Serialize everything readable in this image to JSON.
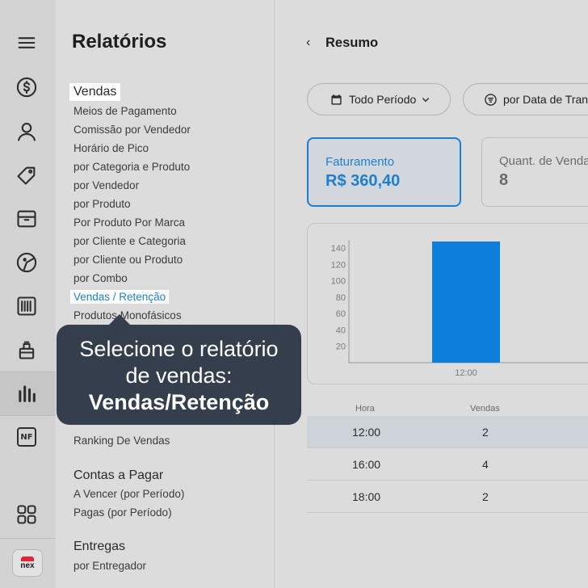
{
  "rail": {
    "icons": [
      "menu-icon",
      "dollar-icon",
      "user-icon",
      "tag-icon",
      "box-icon",
      "pizza-icon",
      "barcode-icon",
      "kitchen-icon",
      "bar-chart-icon",
      "nf-icon",
      "apps-grid-icon"
    ],
    "nf_label": "NF",
    "logo_text": "nex"
  },
  "panel": {
    "title": "Relatórios",
    "groups": {
      "vendas": {
        "label": "Vendas",
        "items": [
          "Meios de Pagamento",
          "Comissão por Vendedor",
          "Horário de Pico",
          "por Categoria e Produto",
          "por Vendedor",
          "por Produto",
          "Por Produto Por Marca",
          "por Cliente e Categoria",
          "por Cliente ou Produto",
          "por Combo",
          "Vendas / Retenção",
          "Produtos Monofásicos",
          "Ranking De Vendas"
        ]
      },
      "contas": {
        "label": "Contas a Pagar",
        "items": [
          "A Vencer (por Período)",
          "Pagas (por Período)"
        ]
      },
      "entregas": {
        "label": "Entregas",
        "items": [
          "por Entregador"
        ]
      }
    }
  },
  "tooltip": {
    "line1": "Selecione o relatório",
    "line2": "de vendas:",
    "line3": "Vendas/Retenção"
  },
  "main": {
    "back_glyph": "‹",
    "title": "Resumo",
    "filters": [
      "Todo Período",
      "por Data de Transação"
    ],
    "cards": [
      {
        "label": "Faturamento",
        "value": "R$ 360,40"
      },
      {
        "label": "Quant. de Vendas",
        "value": "8"
      }
    ],
    "table": {
      "headers": [
        "Hora",
        "Vendas"
      ],
      "rows": [
        {
          "hora": "12:00",
          "vendas": "2"
        },
        {
          "hora": "16:00",
          "vendas": "4"
        },
        {
          "hora": "18:00",
          "vendas": "2"
        }
      ]
    }
  },
  "chart_data": {
    "type": "bar",
    "categories": [
      "12:00"
    ],
    "values": [
      148
    ],
    "yticks": [
      20,
      40,
      60,
      80,
      100,
      120,
      140
    ],
    "ylim": [
      0,
      150
    ],
    "bar_color": "#0c7fdc",
    "title": "",
    "xlabel": "",
    "ylabel": ""
  },
  "colors": {
    "accent": "#1e7fcf",
    "tooltip_bg": "#343e4d",
    "brand_red": "#e0243a"
  }
}
